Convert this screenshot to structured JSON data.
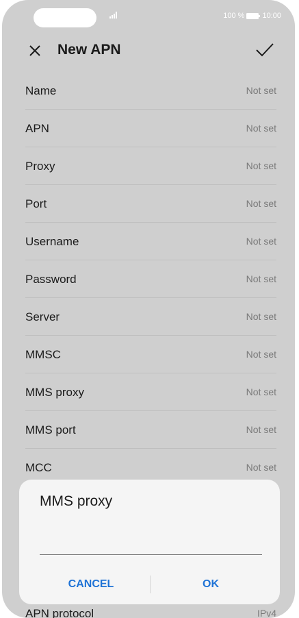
{
  "status_bar": {
    "battery": "100 %",
    "time": "10:00"
  },
  "header": {
    "title": "New APN"
  },
  "settings": [
    {
      "label": "Name",
      "value": "Not set"
    },
    {
      "label": "APN",
      "value": "Not set"
    },
    {
      "label": "Proxy",
      "value": "Not set"
    },
    {
      "label": "Port",
      "value": "Not set"
    },
    {
      "label": "Username",
      "value": "Not set"
    },
    {
      "label": "Password",
      "value": "Not set"
    },
    {
      "label": "Server",
      "value": "Not set"
    },
    {
      "label": "MMSC",
      "value": "Not set"
    },
    {
      "label": "MMS proxy",
      "value": "Not set"
    },
    {
      "label": "MMS port",
      "value": "Not set"
    },
    {
      "label": "MCC",
      "value": "Not set"
    }
  ],
  "partial_row": {
    "label": "APN protocol",
    "value": "IPv4"
  },
  "dialog": {
    "title": "MMS proxy",
    "input_value": "",
    "cancel_label": "CANCEL",
    "ok_label": "OK"
  },
  "colors": {
    "accent": "#1f73d6",
    "background_dim": "#cfcfcf",
    "dialog_bg": "#f5f5f5"
  }
}
